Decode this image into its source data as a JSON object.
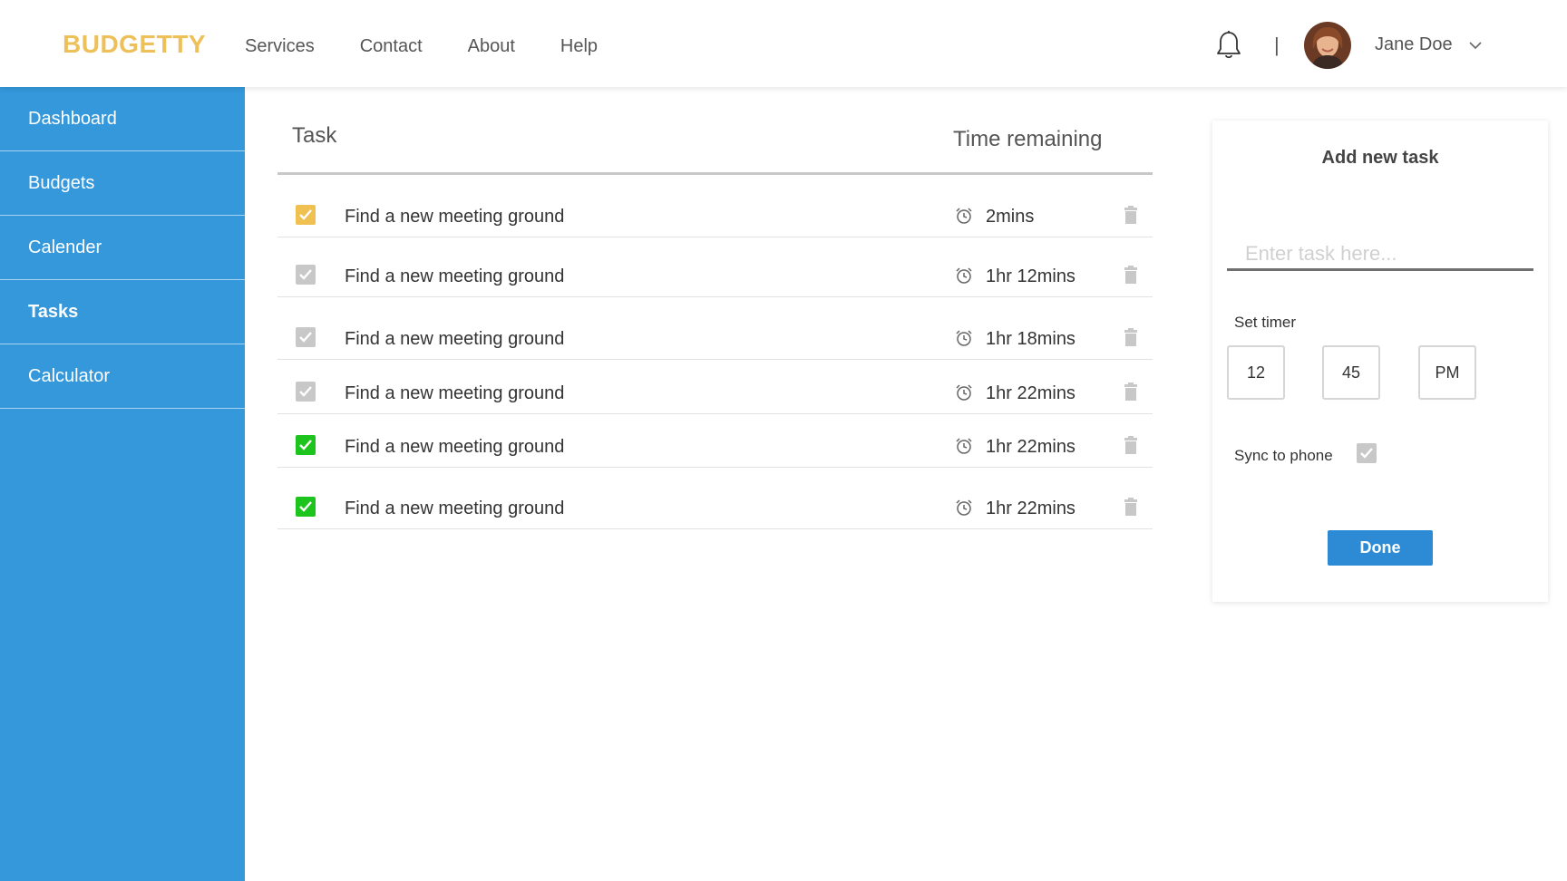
{
  "header": {
    "brand": "BUDGETTY",
    "nav": [
      "Services",
      "Contact",
      "About",
      "Help"
    ],
    "separator": "|",
    "user_name": "Jane Doe",
    "icons": {
      "notifications": "bell-icon",
      "user_menu": "chevron-down-icon"
    }
  },
  "sidebar": {
    "items": [
      {
        "label": "Dashboard",
        "active": false
      },
      {
        "label": "Budgets",
        "active": false
      },
      {
        "label": "Calender",
        "active": false
      },
      {
        "label": "Tasks",
        "active": true
      },
      {
        "label": "Calculator",
        "active": false
      }
    ]
  },
  "tasks": {
    "header_task": "Task",
    "header_time": "Time remaining",
    "rows": [
      {
        "label": "Find a new meeting ground",
        "time": "2mins",
        "check": "yellow"
      },
      {
        "label": "Find a new meeting ground",
        "time": "1hr 12mins",
        "check": "gray"
      },
      {
        "label": "Find a new meeting ground",
        "time": "1hr 18mins",
        "check": "gray"
      },
      {
        "label": "Find a new meeting ground",
        "time": "1hr 22mins",
        "check": "gray"
      },
      {
        "label": "Find a new meeting ground",
        "time": "1hr 22mins",
        "check": "green"
      },
      {
        "label": "Find a new meeting ground",
        "time": "1hr 22mins",
        "check": "green"
      }
    ]
  },
  "add_task": {
    "title": "Add new task",
    "input_placeholder": "Enter task here...",
    "input_value": "",
    "set_timer_label": "Set timer",
    "hour": "12",
    "minute": "45",
    "period": "PM",
    "sync_label": "Sync to phone",
    "sync_checked": true,
    "done_label": "Done"
  },
  "colors": {
    "brand": "#eec05a",
    "sidebar": "#3498db",
    "done_button": "#2d8bd6",
    "check_yellow": "#f0c050",
    "check_gray": "#c8c8c8",
    "check_green": "#1ec41e"
  }
}
